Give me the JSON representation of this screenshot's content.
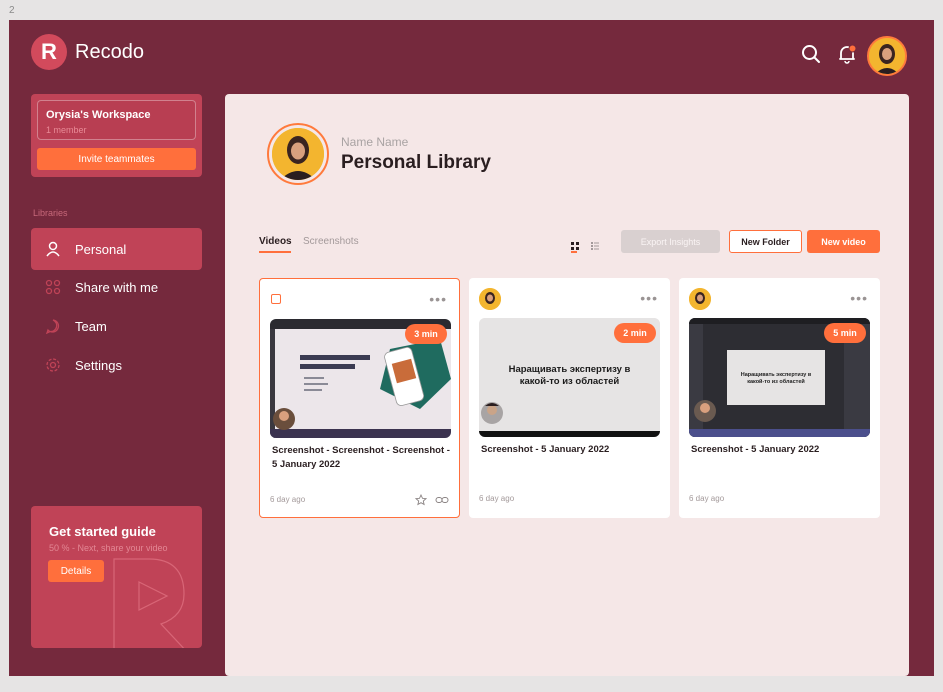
{
  "frame_number": "2",
  "app": {
    "name": "Recodo",
    "logo_letter": "R"
  },
  "header": {
    "notification_dot_color": "#ff6f3c"
  },
  "workspace": {
    "name": "Orysia's Workspace",
    "members": "1 member",
    "invite_label": "Invite teammates"
  },
  "sidebar": {
    "section_label": "Libraries",
    "items": [
      {
        "label": "Personal",
        "icon": "user-icon",
        "active": true
      },
      {
        "label": "Share with me",
        "icon": "share-icon",
        "active": false
      },
      {
        "label": "Team",
        "icon": "team-icon",
        "active": false
      },
      {
        "label": "Settings",
        "icon": "gear-icon",
        "active": false
      }
    ]
  },
  "guide": {
    "title": "Get started guide",
    "progress": "50 %  - Next, share your video",
    "button_label": "Details"
  },
  "profile": {
    "name": "Name Name",
    "title": "Personal Library"
  },
  "tabs": [
    {
      "label": "Videos",
      "active": true
    },
    {
      "label": "Screenshots",
      "active": false
    }
  ],
  "toolbar": {
    "export_label": "Export Insights",
    "new_folder_label": "New Folder",
    "new_video_label": "New video"
  },
  "cards": [
    {
      "duration": "3 min",
      "title": "Screenshot - Screenshot - Screenshot - 5 January 2022",
      "date": "6 day ago",
      "selected": true
    },
    {
      "duration": "2 min",
      "title": "Screenshot - 5 January 2022",
      "date": "6 day ago",
      "thumb_text": "Наращивать экспертизу в какой-то из областей"
    },
    {
      "duration": "5 min",
      "title": "Screenshot - 5 January 2022",
      "date": "6 day ago",
      "thumb_text": "Наращивать экспертизу в какой-то из областей"
    }
  ],
  "colors": {
    "accent": "#ff6f3c",
    "background": "#75293d",
    "panel": "#c04357",
    "main": "#f5e7e7"
  }
}
